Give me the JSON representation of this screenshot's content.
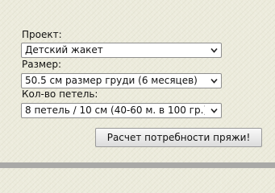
{
  "form": {
    "project": {
      "label": "Проект:",
      "value": "Детский жакет"
    },
    "size": {
      "label": "Размер:",
      "value": "50.5 см размер груди (6 месяцев)"
    },
    "stitches": {
      "label": "Кол-во петель:",
      "value": "8 петель / 10 см (40-60 м. в 100 гр.)"
    },
    "calculate_label": "Расчет потребности пряжи!"
  },
  "icons": {
    "dropdown": "chevron-down-icon"
  },
  "colors": {
    "background": "#ecebdc",
    "field_background": "#ffffff",
    "bottom_bar": "#a9a9a7"
  }
}
